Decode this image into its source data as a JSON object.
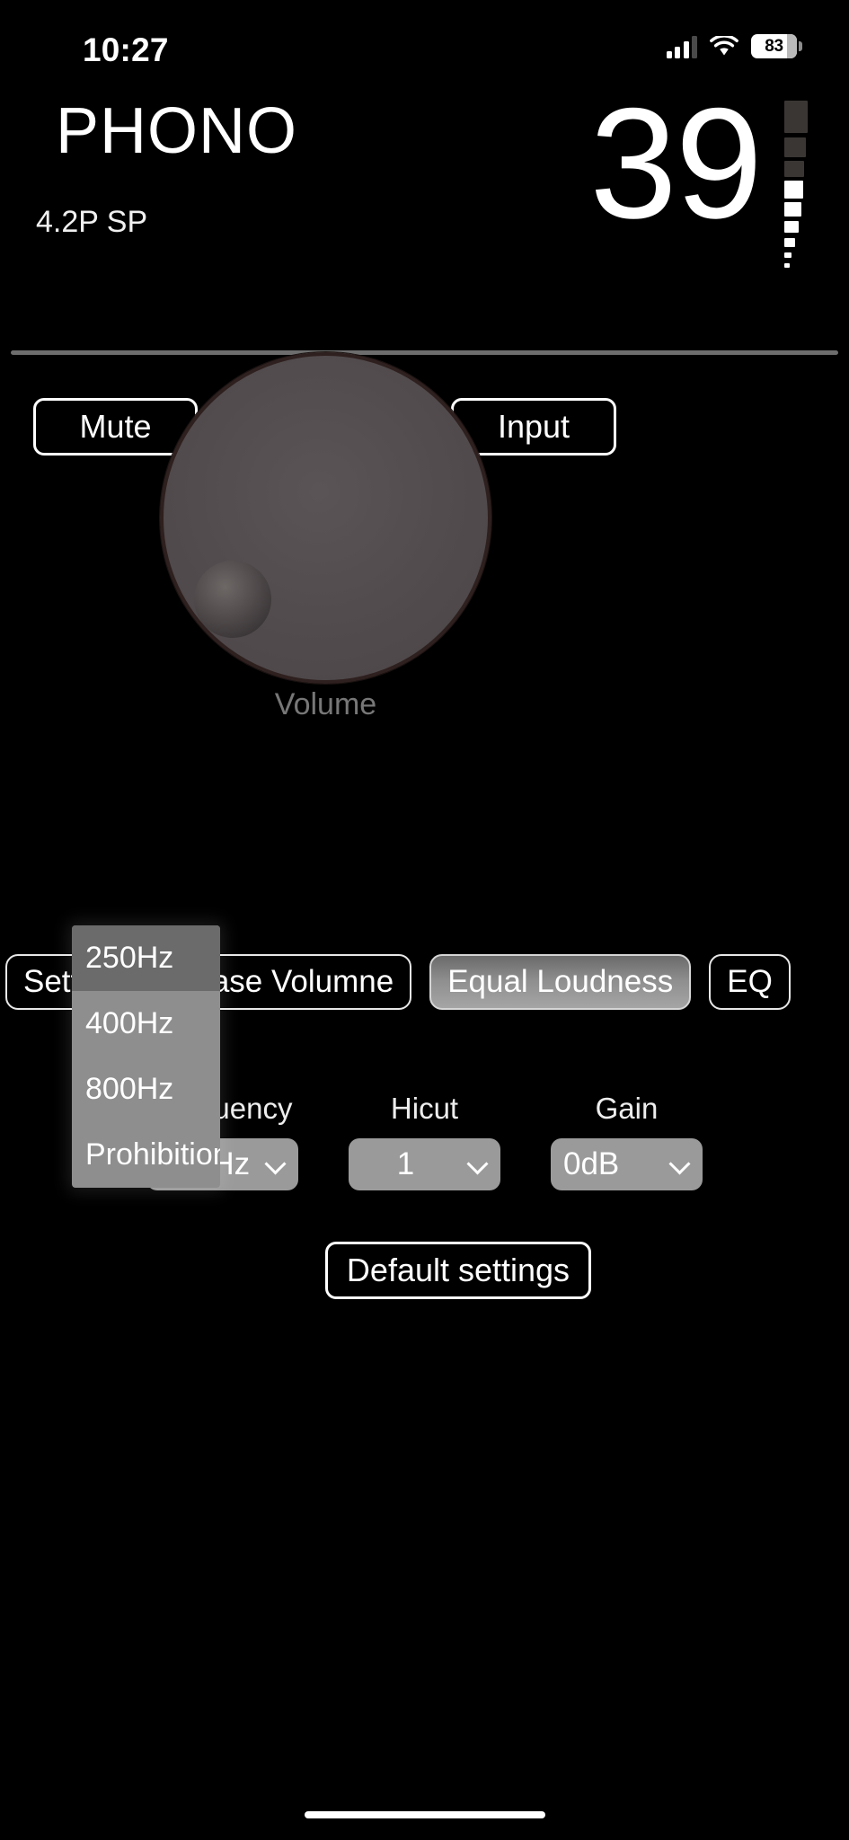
{
  "status_bar": {
    "time": "10:27",
    "signal_icon": "cellular-signal-icon",
    "wifi_icon": "wifi-icon",
    "battery_percent": "83",
    "battery_icon": "battery-icon"
  },
  "header": {
    "source_title": "PHONO",
    "source_detail": "4.2P SP",
    "volume_value": "39",
    "meter_icon": "volume-level-meter-icon",
    "meter": {
      "total_segments": 9,
      "filled_segments": 6
    }
  },
  "controls": {
    "mute_label": "Mute",
    "input_label": "Input",
    "knob_label": "Volume",
    "knob_icon": "volume-knob-dial"
  },
  "tabs": [
    {
      "label": "Settings",
      "active": false
    },
    {
      "label": "Base Volumne",
      "active": false
    },
    {
      "label": "Equal Loudness",
      "active": true
    },
    {
      "label": "EQ",
      "active": false
    }
  ],
  "equal_loudness": {
    "fields": [
      {
        "label": "Frequency",
        "value": "250Hz",
        "align": "left",
        "chevron_icon": "chevron-down-icon"
      },
      {
        "label": "Hicut",
        "value": "1",
        "align": "center",
        "chevron_icon": "chevron-down-icon"
      },
      {
        "label": "Gain",
        "value": "0dB",
        "align": "left",
        "chevron_icon": "chevron-down-icon"
      }
    ],
    "open_dropdown": {
      "field": "Frequency",
      "options": [
        {
          "label": "250Hz",
          "selected": true
        },
        {
          "label": "400Hz",
          "selected": false
        },
        {
          "label": "800Hz",
          "selected": false
        },
        {
          "label": "Prohibition",
          "selected": false
        }
      ]
    },
    "default_settings_label": "Default settings"
  },
  "colors": {
    "background": "#000000",
    "text": "#ffffff",
    "divider": "#6d6d6d",
    "knob_face": "#514b4d",
    "knob_ring": "#2e201e",
    "select_bg": "#9a9a9a",
    "dropdown_bg": "#8e8e8e",
    "dropdown_selected_bg": "#6b6b6b",
    "tab_active_bg": "#8f8f8f",
    "muted_text": "#777777",
    "meter_off": "#3a3634",
    "meter_on": "#ffffff"
  }
}
